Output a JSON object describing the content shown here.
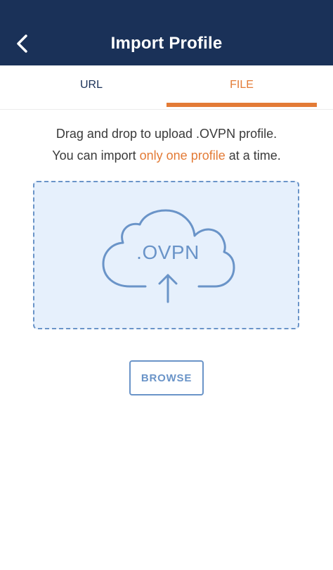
{
  "header": {
    "title": "Import Profile",
    "back_icon": "chevron-left-icon"
  },
  "tabs": [
    {
      "label": "URL",
      "active": false
    },
    {
      "label": "FILE",
      "active": true
    }
  ],
  "instructions": {
    "line1": "Drag and drop to upload .OVPN profile.",
    "line2_before": "You can import ",
    "line2_highlight": "only one profile",
    "line2_after": " at a time."
  },
  "dropzone": {
    "label": ".OVPN",
    "icon": "cloud-upload-icon"
  },
  "browse_button": {
    "label": "BROWSE"
  },
  "colors": {
    "header_bg": "#1a3158",
    "accent": "#e37b36",
    "dropzone_border": "#6a94c8",
    "dropzone_bg": "#e6f0fc"
  }
}
